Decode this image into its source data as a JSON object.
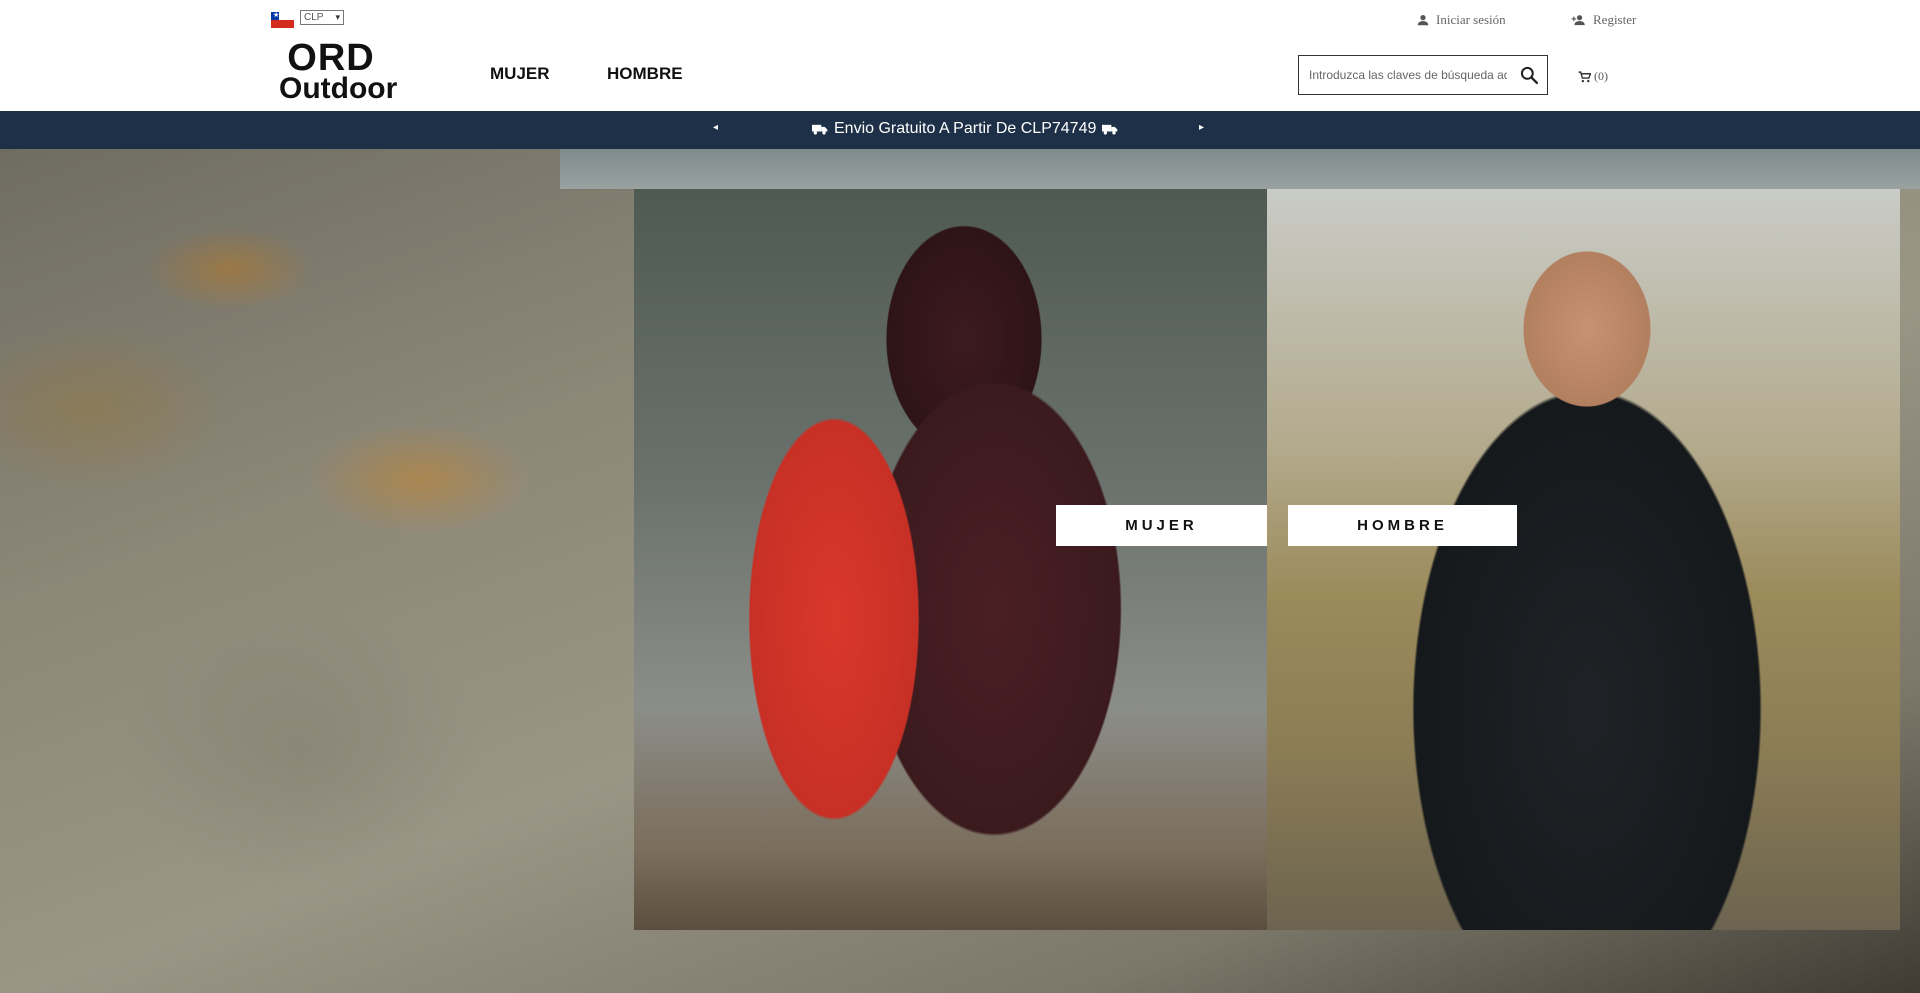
{
  "header": {
    "currency": "CLP",
    "logo": {
      "line1": "ORD",
      "line2": "Outdoor"
    },
    "nav": [
      {
        "label": "MUJER"
      },
      {
        "label": "HOMBRE"
      }
    ],
    "account": {
      "login_label": "Iniciar sesión",
      "register_label": "Register"
    },
    "search": {
      "placeholder": "Introduzca las claves de búsqueda aquí"
    },
    "cart": {
      "count_label": "(0)"
    }
  },
  "announcement": {
    "message": "Envio Gratuito A Partir De CLP74749",
    "icon": "truck-icon"
  },
  "hero": {
    "buttons": [
      {
        "label": "MUJER"
      },
      {
        "label": "HOMBRE"
      }
    ]
  },
  "colors": {
    "announce_bg": "#1d3047",
    "button_bg": "#ffffff",
    "text": "#111111"
  }
}
